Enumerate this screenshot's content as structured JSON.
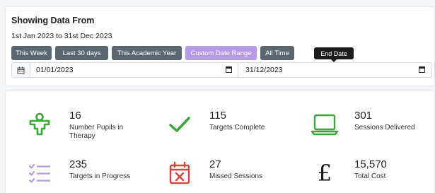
{
  "filter": {
    "title": "Showing Data From",
    "range_text": "1st Jan 2023 to 31st Dec 2023",
    "buttons": [
      {
        "label": "This Week",
        "active": false
      },
      {
        "label": "Last 30 days",
        "active": false
      },
      {
        "label": "This Academic Year",
        "active": false
      },
      {
        "label": "Custom Date Range",
        "active": true
      },
      {
        "label": "All Time",
        "active": false
      }
    ],
    "tooltip": "End Date",
    "start_date": "01/01/2023",
    "end_date": "31/12/2023"
  },
  "colors": {
    "button_bg": "#5b6770",
    "button_active_bg": "#b59ae8",
    "green": "#3aa63a",
    "purple": "#b59ae8",
    "red": "#e0403a"
  },
  "stats": [
    {
      "value": "16",
      "label": "Number Pupils in Therapy",
      "icon": "child-icon"
    },
    {
      "value": "115",
      "label": "Targets Complete",
      "icon": "checkmark-icon"
    },
    {
      "value": "301",
      "label": "Sessions Delivered",
      "icon": "laptop-icon"
    },
    {
      "value": "235",
      "label": "Targets in Progress",
      "icon": "checklist-icon"
    },
    {
      "value": "27",
      "label": "Missed Sessions",
      "icon": "calendar-x-icon"
    },
    {
      "value": "15,570",
      "label": "Total Cost",
      "icon": "pound-icon"
    }
  ]
}
